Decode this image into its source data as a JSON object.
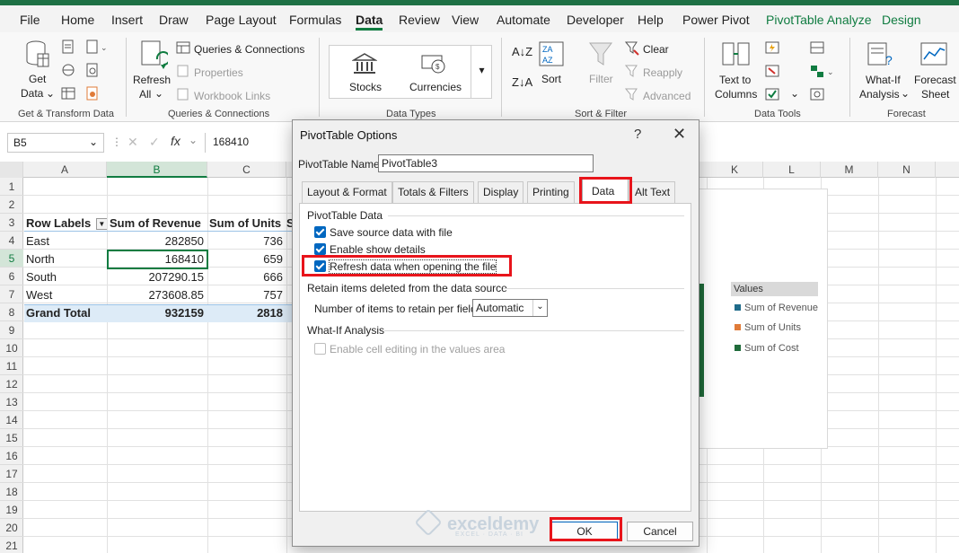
{
  "ribbon_tabs": [
    "File",
    "Home",
    "Insert",
    "Draw",
    "Page Layout",
    "Formulas",
    "Data",
    "Review",
    "View",
    "Automate",
    "Developer",
    "Help",
    "Power Pivot",
    "PivotTable Analyze",
    "Design"
  ],
  "ribbon": {
    "get_data": "Get",
    "get_data2": "Data",
    "refresh": "Refresh",
    "refresh2": "All",
    "queries_connections": "Queries & Connections",
    "properties": "Properties",
    "workbook_links": "Workbook Links",
    "stocks": "Stocks",
    "currencies": "Currencies",
    "sort": "Sort",
    "filter": "Filter",
    "clear": "Clear",
    "reapply": "Reapply",
    "advanced": "Advanced",
    "text_to": "Text to",
    "columns": "Columns",
    "what_if": "What-If",
    "analysis": "Analysis",
    "forecast": "Forecast",
    "sheet": "Sheet",
    "groups": {
      "get_transform": "Get & Transform Data",
      "queries": "Queries & Connections",
      "data_types": "Data Types",
      "sort_filter": "Sort & Filter",
      "data_tools": "Data Tools",
      "forecast": "Forecast"
    }
  },
  "formula_bar": {
    "name_box": "B5",
    "fx": "fx",
    "value": "168410"
  },
  "columns": [
    "A",
    "B",
    "C",
    "K",
    "L",
    "M",
    "N"
  ],
  "col_s": "S",
  "rows": [
    "1",
    "2",
    "3",
    "4",
    "5",
    "6",
    "7",
    "8",
    "9",
    "10",
    "11",
    "12",
    "13",
    "14",
    "15",
    "16",
    "17",
    "18",
    "19",
    "20",
    "21"
  ],
  "pivot": {
    "headers": [
      "Row Labels",
      "Sum of Revenue",
      "Sum of Units"
    ],
    "rows": [
      [
        "East",
        "282850",
        "736"
      ],
      [
        "North",
        "168410",
        "659"
      ],
      [
        "South",
        "207290.15",
        "666"
      ],
      [
        "West",
        "273608.85",
        "757"
      ]
    ],
    "total": [
      "Grand Total",
      "932159",
      "2818"
    ]
  },
  "chart_legend": {
    "title": "Values",
    "items": [
      {
        "label": "Sum of Revenue",
        "color": "#1f6b8a"
      },
      {
        "label": "Sum of Units",
        "color": "#e07b39"
      },
      {
        "label": "Sum of Cost",
        "color": "#1f6b3a"
      }
    ]
  },
  "dialog": {
    "title": "PivotTable Options",
    "help": "?",
    "close": "✕",
    "name_label": "PivotTable Name:",
    "name_value": "PivotTable3",
    "tabs": [
      "Layout & Format",
      "Totals & Filters",
      "Display",
      "Printing",
      "Data",
      "Alt Text"
    ],
    "pivot_data_section": "PivotTable Data",
    "save_source": "Save source data with file",
    "enable_details": "Enable show details",
    "refresh_on_open": "Refresh data when opening the file",
    "retain_section": "Retain items deleted from the data source",
    "retain_label": "Number of items to retain per field:",
    "retain_value": "Automatic",
    "whatif_section": "What-If Analysis",
    "enable_editing": "Enable cell editing in the values area",
    "ok": "OK",
    "cancel": "Cancel"
  },
  "watermark": {
    "name": "exceldemy",
    "tagline": "EXCEL · DATA · BI"
  }
}
